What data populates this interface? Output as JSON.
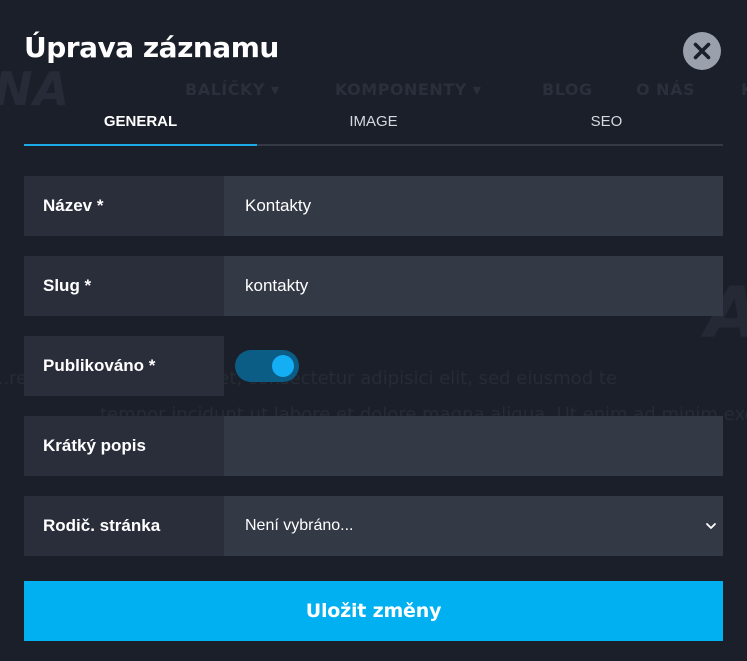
{
  "background": {
    "logo": "NA",
    "nav": [
      "BALÍČKY ▾",
      "KOMPONENTY ▾",
      "BLOG",
      "O NÁS",
      "K"
    ],
    "hero_letter": "A",
    "text_line_1": "...rem ipsum dolor sit amet, consectetur adipisici elit, sed eiusmod te",
    "text_line_2": "tempor incidunt ut labore et dolore magna aliqua. Ut enim ad minim exe"
  },
  "modal": {
    "title": "Úprava záznamu",
    "close_icon": "close-icon"
  },
  "tabs": [
    {
      "label": "GENERAL",
      "active": true
    },
    {
      "label": "IMAGE",
      "active": false
    },
    {
      "label": "SEO",
      "active": false
    }
  ],
  "form": {
    "name": {
      "label": "Název *",
      "value": "Kontakty"
    },
    "slug": {
      "label": "Slug *",
      "value": "kontakty"
    },
    "published": {
      "label": "Publikováno *",
      "value": true
    },
    "short_desc": {
      "label": "Krátký popis",
      "value": ""
    },
    "parent_page": {
      "label": "Rodič. stránka",
      "value": "Není vybráno..."
    }
  },
  "save_label": "Uložit změny",
  "colors": {
    "background": "#1b1f29",
    "accent": "#00b0f0",
    "tab_underline": "#1ca9e7",
    "label_bg": "#2a2e3b",
    "field_bg": "#343946"
  }
}
